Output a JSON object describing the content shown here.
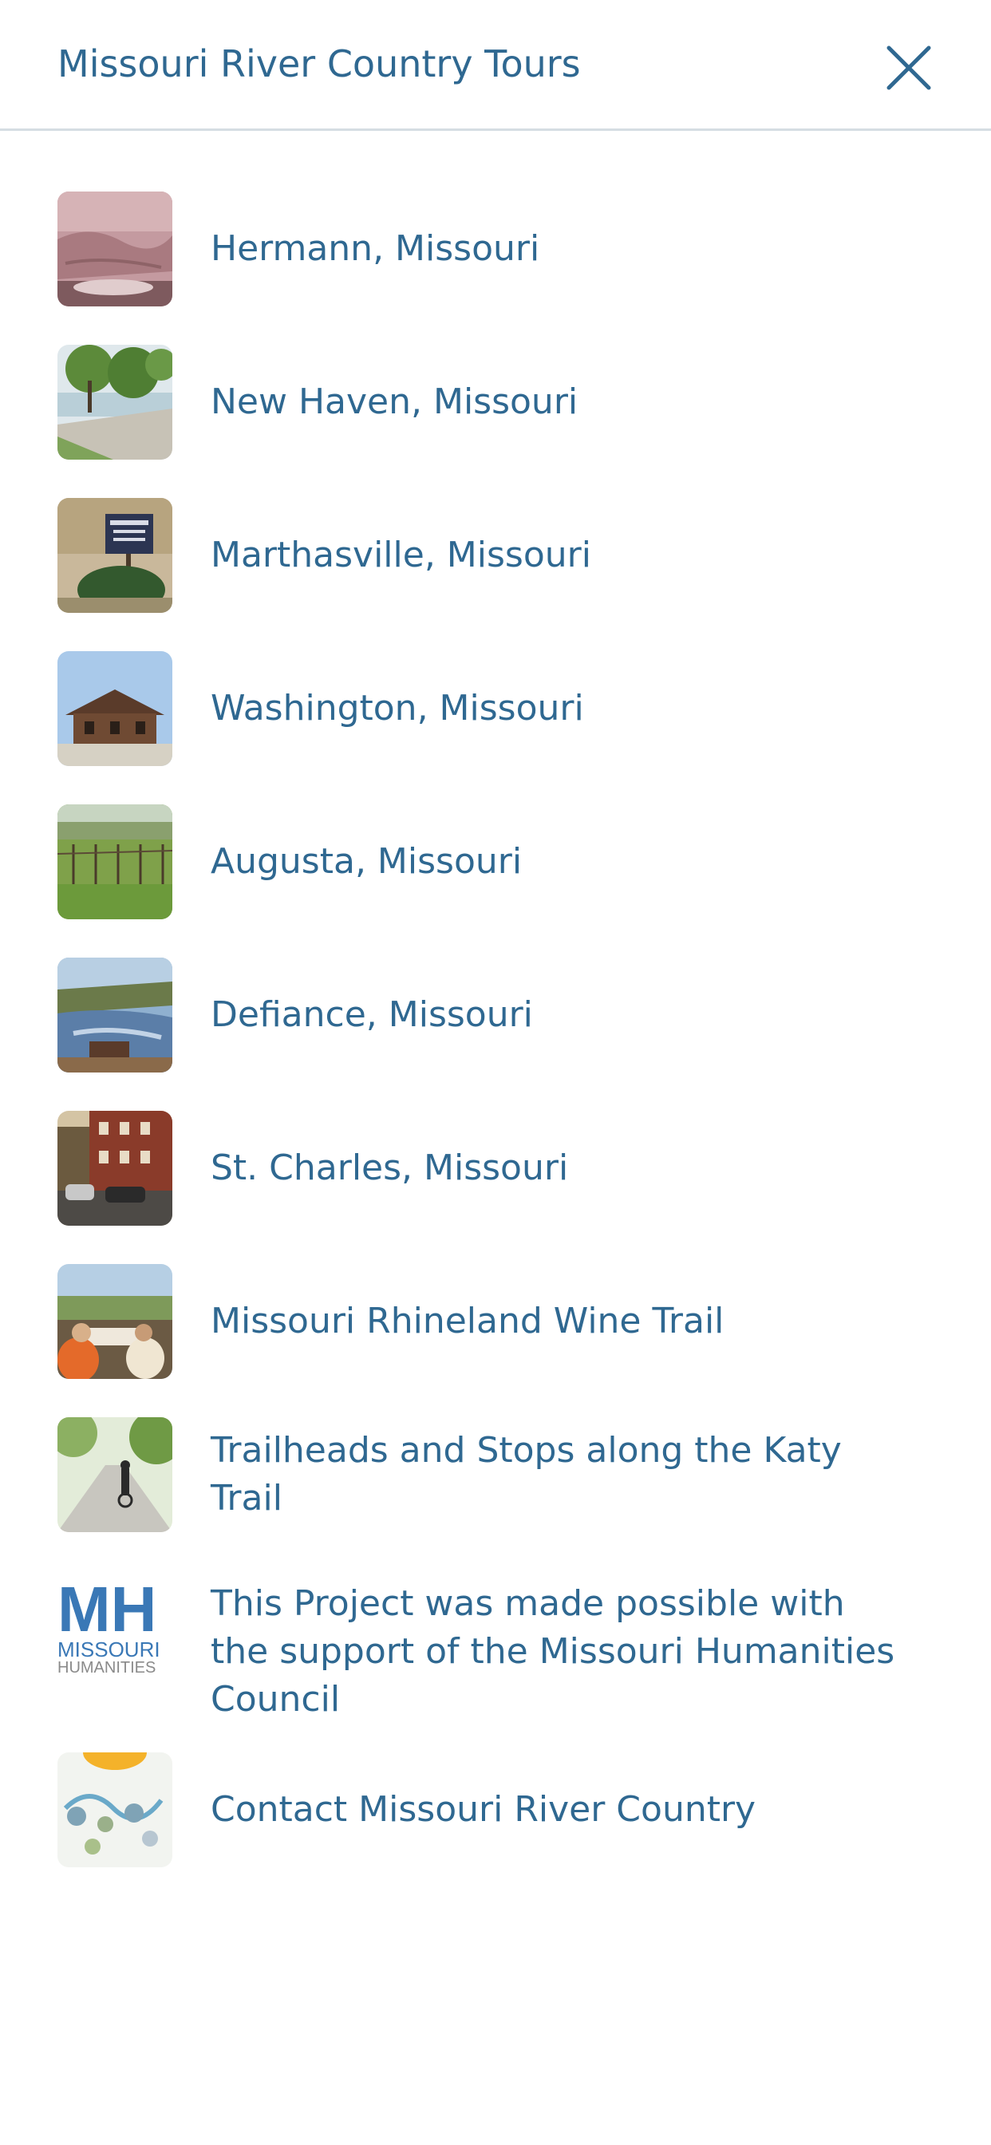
{
  "header": {
    "title": "Missouri River Country Tours",
    "close_icon": "close-icon"
  },
  "menu": {
    "items": [
      {
        "label": "Hermann, Missouri",
        "thumb": "hermann-photo"
      },
      {
        "label": "New Haven, Missouri",
        "thumb": "new-haven-photo"
      },
      {
        "label": "Marthasville, Missouri",
        "thumb": "marthasville-photo"
      },
      {
        "label": "Washington, Missouri",
        "thumb": "washington-photo"
      },
      {
        "label": "Augusta, Missouri",
        "thumb": "augusta-photo"
      },
      {
        "label": "Defiance, Missouri",
        "thumb": "defiance-photo"
      },
      {
        "label": "St. Charles, Missouri",
        "thumb": "st-charles-photo"
      },
      {
        "label": "Missouri Rhineland Wine Trail",
        "thumb": "wine-trail-photo"
      },
      {
        "label": "Trailheads and Stops along the Katy Trail",
        "thumb": "katy-trail-photo"
      },
      {
        "label": "This Project was made possible with the support of the Missouri Humanities Council",
        "thumb": "missouri-humanities-logo"
      },
      {
        "label": "Contact Missouri River Country",
        "thumb": "map-photo"
      }
    ],
    "logo_text": {
      "mh": "MH",
      "missouri": "MISSOURI",
      "humanities": "HUMANITIES"
    }
  },
  "colors": {
    "text": "#2f6891",
    "divider": "#d5dde3",
    "background": "#ffffff"
  }
}
